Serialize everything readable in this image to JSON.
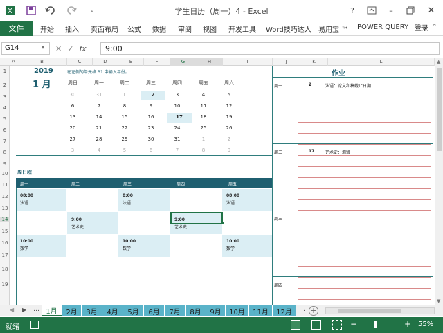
{
  "window": {
    "title": "学生日历（周一）4 - Excel",
    "help": "?"
  },
  "ribbon": {
    "file": "文件",
    "tabs": [
      "开始",
      "插入",
      "页面布局",
      "公式",
      "数据",
      "审阅",
      "视图",
      "开发工具",
      "Word技巧达人",
      "易用宝 ™",
      "POWER QUERY"
    ],
    "login": "登录"
  },
  "formula_bar": {
    "name_box": "G14",
    "fx": "fx",
    "value": "9:00"
  },
  "columns": [
    "A",
    "B",
    "C",
    "D",
    "E",
    "F",
    "G",
    "H",
    "I",
    "J",
    "K",
    "L"
  ],
  "rows": [
    "1",
    "2",
    "3",
    "4",
    "5",
    "6",
    "7",
    "8",
    "9",
    "10",
    "11",
    "12",
    "13",
    "14",
    "15",
    "16",
    "17",
    "18",
    "19"
  ],
  "calendar": {
    "year": "2019",
    "hint": "在左侧的单元格 B1 中输入年份。",
    "month": "1 月",
    "weekdays": [
      "周日",
      "周一",
      "周二",
      "周三",
      "周四",
      "周五",
      "周六"
    ],
    "weeks": [
      [
        "30",
        "31",
        "1",
        "2",
        "3",
        "4",
        "5"
      ],
      [
        "6",
        "7",
        "8",
        "9",
        "10",
        "11",
        "12"
      ],
      [
        "13",
        "14",
        "15",
        "16",
        "17",
        "18",
        "19"
      ],
      [
        "20",
        "21",
        "22",
        "23",
        "24",
        "25",
        "26"
      ],
      [
        "27",
        "28",
        "29",
        "30",
        "31",
        "1",
        "2"
      ],
      [
        "3",
        "4",
        "5",
        "6",
        "7",
        "8",
        "9"
      ]
    ]
  },
  "schedule": {
    "title": "周日程",
    "days": [
      "周一",
      "周二",
      "周三",
      "周四",
      "周五"
    ],
    "entries": [
      {
        "time": "08:00",
        "name": "法语"
      },
      {
        "time": "8:00",
        "name": "法语"
      },
      {
        "time": "08:00",
        "name": "法语"
      },
      {
        "time": "9:00",
        "name": "艺术史"
      },
      {
        "time": "9:00",
        "name": "艺术史"
      },
      {
        "time": "10:00",
        "name": "数学"
      },
      {
        "time": "10:00",
        "name": "数学"
      },
      {
        "time": "10:00",
        "name": "数学"
      }
    ]
  },
  "homework": {
    "title": "作业",
    "days": [
      {
        "label": "周一",
        "day": "2",
        "note": "法语：论文和稿截止日期"
      },
      {
        "label": "周二",
        "day": "17",
        "note": "艺术史：测验"
      },
      {
        "label": "周三",
        "day": "",
        "note": ""
      },
      {
        "label": "周四",
        "day": "",
        "note": ""
      }
    ]
  },
  "sheet_tabs": [
    "1月",
    "2月",
    "3月",
    "4月",
    "5月",
    "6月",
    "7月",
    "8月",
    "9月",
    "10月",
    "11月",
    "12月"
  ],
  "status": {
    "ready": "就绪",
    "zoom": "55%"
  },
  "colors": {
    "accent": "#217346",
    "teal": "#1f5f70",
    "light": "#dbeef4",
    "tab": "#5ab3c9"
  }
}
